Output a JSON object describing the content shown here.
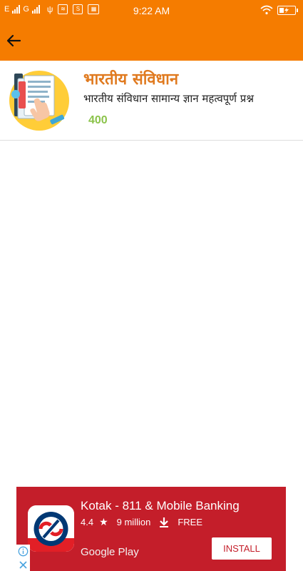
{
  "status_bar": {
    "network_1": "E",
    "network_2": "G",
    "time": "9:22 AM",
    "icons": [
      "signal-icon",
      "usb-icon",
      "notification-icon",
      "sim-icon",
      "film-icon",
      "wifi-icon",
      "battery-charging-icon"
    ]
  },
  "app_bar": {
    "back_icon": "arrow-back-icon",
    "background": "#F57C00"
  },
  "list": {
    "items": [
      {
        "title": "भारतीय संविधान",
        "subtitle": "भारतीय संविधान सामान्य ज्ञान महत्वपूर्ण प्रश्न",
        "count": "400",
        "thumbnail_icon": "document-touch-icon"
      }
    ]
  },
  "ad": {
    "title": "Kotak - 811 & Mobile Banking",
    "rating": "4.4",
    "downloads": "9 million",
    "price": "FREE",
    "store": "Google Play",
    "install_label": "INSTALL",
    "background": "#C41E2A"
  }
}
